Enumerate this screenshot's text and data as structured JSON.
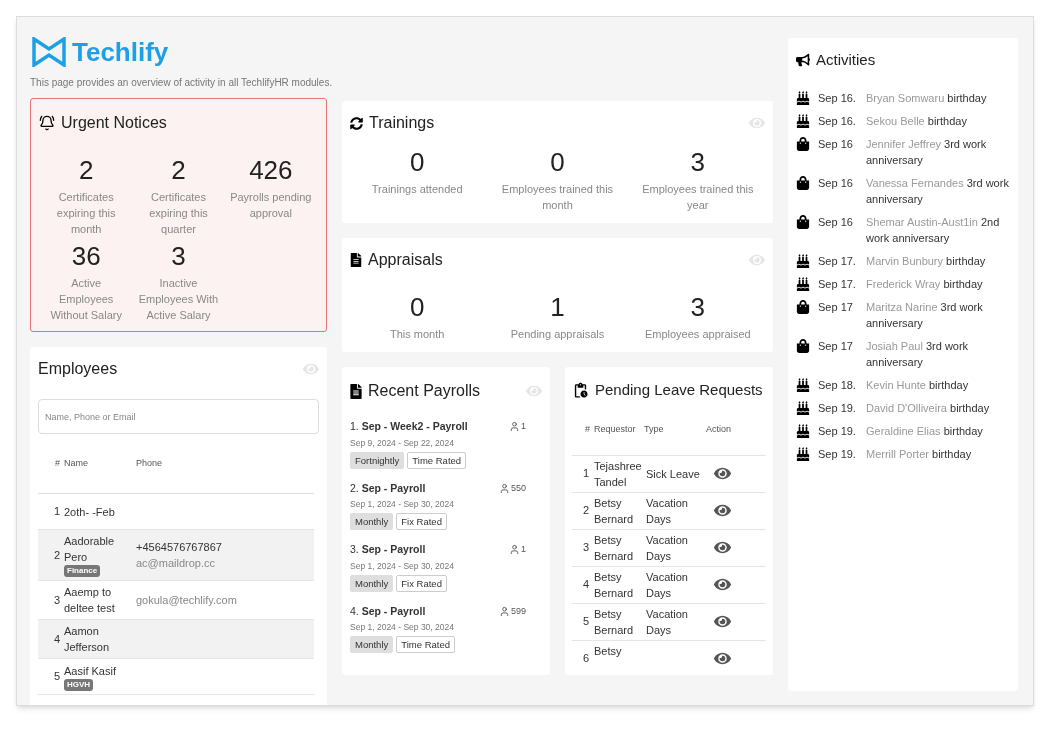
{
  "brand": {
    "name": "Techlify",
    "subtitle": "This page provides an overview of activity in all TechlifyHR modules."
  },
  "urgent_notices": {
    "title": "Urgent Notices",
    "stats": [
      {
        "value": "2",
        "label": "Certificates expiring this month"
      },
      {
        "value": "2",
        "label": "Certificates expiring this quarter"
      },
      {
        "value": "426",
        "label": "Payrolls pending approval"
      },
      {
        "value": "36",
        "label": "Active Employees Without Salary"
      },
      {
        "value": "3",
        "label": "Inactive Employees With Active Salary"
      }
    ]
  },
  "trainings": {
    "title": "Trainings",
    "stats": [
      {
        "value": "0",
        "label": "Trainings attended"
      },
      {
        "value": "0",
        "label": "Employees trained this month"
      },
      {
        "value": "3",
        "label": "Employees trained this year"
      }
    ]
  },
  "appraisals": {
    "title": "Appraisals",
    "stats": [
      {
        "value": "0",
        "label": "This month"
      },
      {
        "value": "1",
        "label": "Pending appraisals"
      },
      {
        "value": "3",
        "label": "Employees appraised"
      }
    ]
  },
  "employees": {
    "title": "Employees",
    "search": {
      "placeholder": "Name, Phone or Email"
    },
    "columns": [
      "#",
      "Name",
      "Phone"
    ],
    "rows": [
      {
        "number": "1",
        "name": "2oth- -Feb"
      },
      {
        "number": "2",
        "name": "Aadorable Pero",
        "tag": "Finance",
        "phone": "+4564576767867",
        "email": "ac@maildrop.cc"
      },
      {
        "number": "3",
        "name": "Aaemp to deltee test",
        "email": "gokula@techlify.com"
      },
      {
        "number": "4",
        "name": "Aamon Jefferson"
      },
      {
        "number": "5",
        "name": "Aasif Kasif",
        "tag": "HGVH"
      }
    ]
  },
  "recent_payrolls": {
    "title": "Recent Payrolls",
    "items": [
      {
        "title": "1. **Sep - Week2 - Payroll**",
        "count": "1",
        "period": "Sep 9, 2024 - Sep 22, 2024",
        "tags": [
          {
            "label": "Fortnightly",
            "kind": "filled"
          },
          {
            "label": "Time Rated",
            "kind": "outlined"
          }
        ]
      },
      {
        "title": "2. **Sep - Payroll**",
        "count": "550",
        "period": "Sep 1, 2024 - Sep 30, 2024",
        "tags": [
          {
            "label": "Monthly",
            "kind": "filled"
          },
          {
            "label": "Fix Rated",
            "kind": "outlined"
          }
        ]
      },
      {
        "title": "3. **Sep - Payroll**",
        "count": "1",
        "period": "Sep 1, 2024 - Sep 30, 2024",
        "tags": [
          {
            "label": "Monthly",
            "kind": "filled"
          },
          {
            "label": "Fix Rated",
            "kind": "outlined"
          }
        ]
      },
      {
        "title": "4. **Sep - Payroll**",
        "count": "599",
        "period": "Sep 1, 2024 - Sep 30, 2024",
        "tags": [
          {
            "label": "Monthly",
            "kind": "filled"
          },
          {
            "label": "Time Rated",
            "kind": "outlined"
          }
        ]
      }
    ]
  },
  "pending_leave_requests": {
    "title": "Pending Leave Requests",
    "columns": [
      "#",
      "Requestor",
      "Type",
      "Action"
    ],
    "rows": [
      {
        "number": "1",
        "requestor": "Tejashree Tandel",
        "type": "Sick Leave"
      },
      {
        "number": "2",
        "requestor": "Betsy Bernard",
        "type": "Vacation Days"
      },
      {
        "number": "3",
        "requestor": "Betsy Bernard",
        "type": "Vacation Days"
      },
      {
        "number": "4",
        "requestor": "Betsy Bernard",
        "type": "Vacation Days"
      },
      {
        "number": "5",
        "requestor": "Betsy Bernard",
        "type": "Vacation Days"
      },
      {
        "number": "6",
        "requestor": "Betsy"
      }
    ]
  },
  "activities": {
    "title": "Activities",
    "items": [
      {
        "kind": "birthday",
        "date": "Sep 16.",
        "name": "Bryan Somwaru",
        "event": "birthday"
      },
      {
        "kind": "birthday",
        "date": "Sep 16.",
        "name": "Sekou Belle",
        "event": "birthday"
      },
      {
        "kind": "anniversary",
        "date": "Sep 16",
        "name": "Jennifer Jeffrey",
        "event": "3rd work anniversary"
      },
      {
        "kind": "anniversary",
        "date": "Sep 16",
        "name": "Vanessa Fernandes",
        "event": "3rd work anniversary"
      },
      {
        "kind": "anniversary",
        "date": "Sep 16",
        "name": "Shemar Austin-Aust1in",
        "event": "2nd work anniversary"
      },
      {
        "kind": "birthday",
        "date": "Sep 17.",
        "name": "Marvin Bunbury",
        "event": "birthday"
      },
      {
        "kind": "birthday",
        "date": "Sep 17.",
        "name": "Frederick Wray",
        "event": "birthday"
      },
      {
        "kind": "anniversary",
        "date": "Sep 17",
        "name": "Maritza Narine",
        "event": "3rd work anniversary"
      },
      {
        "kind": "anniversary",
        "date": "Sep 17",
        "name": "Josiah Paul",
        "event": "3rd work anniversary"
      },
      {
        "kind": "birthday",
        "date": "Sep 18.",
        "name": "Kevin Hunte",
        "event": "birthday"
      },
      {
        "kind": "birthday",
        "date": "Sep 19.",
        "name": "David D'Olliveira",
        "event": "birthday"
      },
      {
        "kind": "birthday",
        "date": "Sep 19.",
        "name": "Geraldine Elias",
        "event": "birthday"
      },
      {
        "kind": "birthday",
        "date": "Sep 19.",
        "name": "Merrill Porter",
        "event": "birthday"
      }
    ]
  }
}
